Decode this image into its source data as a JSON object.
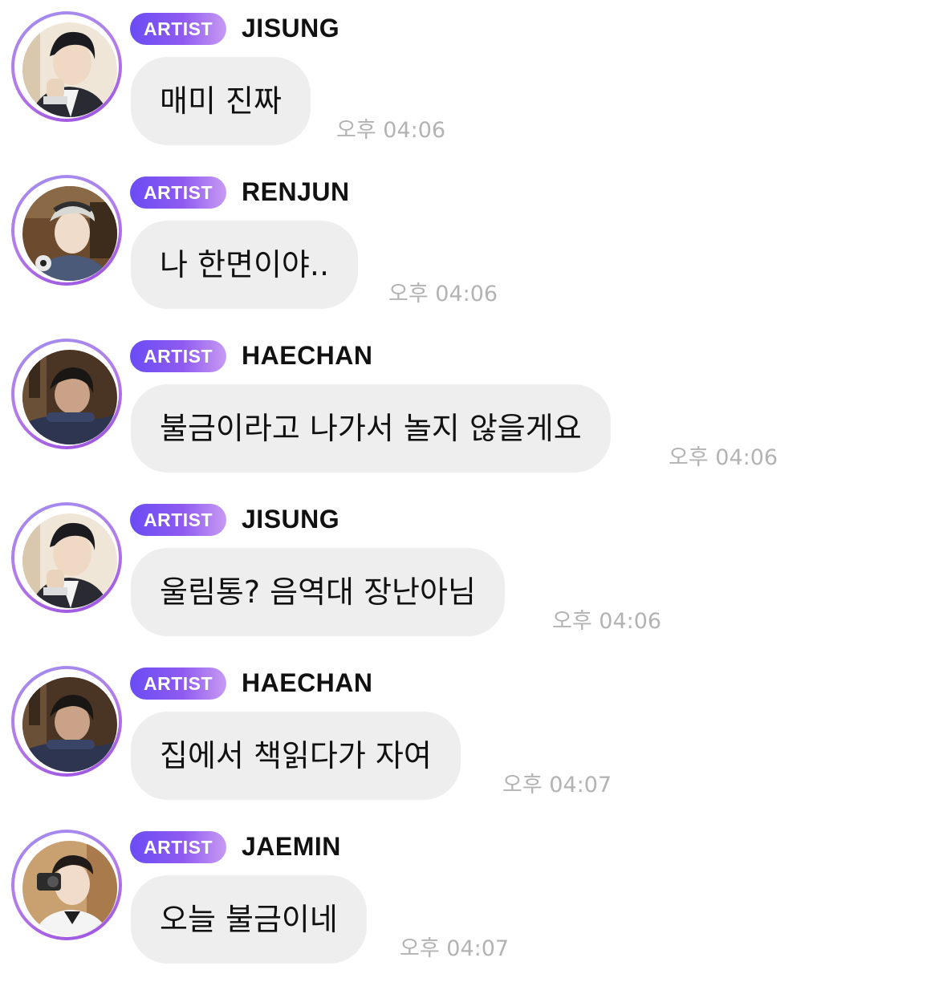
{
  "chat": {
    "messages": [
      {
        "badge": "ARTIST",
        "sender": "JISUNG",
        "avatar_icon": "jisung-avatar",
        "text": "매미 진짜",
        "time": "오후 04:06"
      },
      {
        "badge": "ARTIST",
        "sender": "RENJUN",
        "avatar_icon": "renjun-avatar",
        "text": "나 한면이야..",
        "time": "오후 04:06"
      },
      {
        "badge": "ARTIST",
        "sender": "HAECHAN",
        "avatar_icon": "haechan-avatar",
        "text": "불금이라고 나가서 놀지 않을게요",
        "time": "오후 04:06"
      },
      {
        "badge": "ARTIST",
        "sender": "JISUNG",
        "avatar_icon": "jisung-avatar",
        "text": "울림통? 음역대 장난아님",
        "time": "오후 04:06"
      },
      {
        "badge": "ARTIST",
        "sender": "HAECHAN",
        "avatar_icon": "haechan-avatar",
        "text": "집에서 책읽다가 자여",
        "time": "오후 04:07"
      },
      {
        "badge": "ARTIST",
        "sender": "JAEMIN",
        "avatar_icon": "jaemin-avatar",
        "text": "오늘 불금이네",
        "time": "오후 04:07"
      }
    ]
  },
  "colors": {
    "badge_gradient_start": "#6a4cf5",
    "badge_gradient_end": "#c89af2",
    "bubble_bg": "#eeeeee",
    "timestamp": "#b3b3b3",
    "avatar_ring": "#a08ef0"
  }
}
